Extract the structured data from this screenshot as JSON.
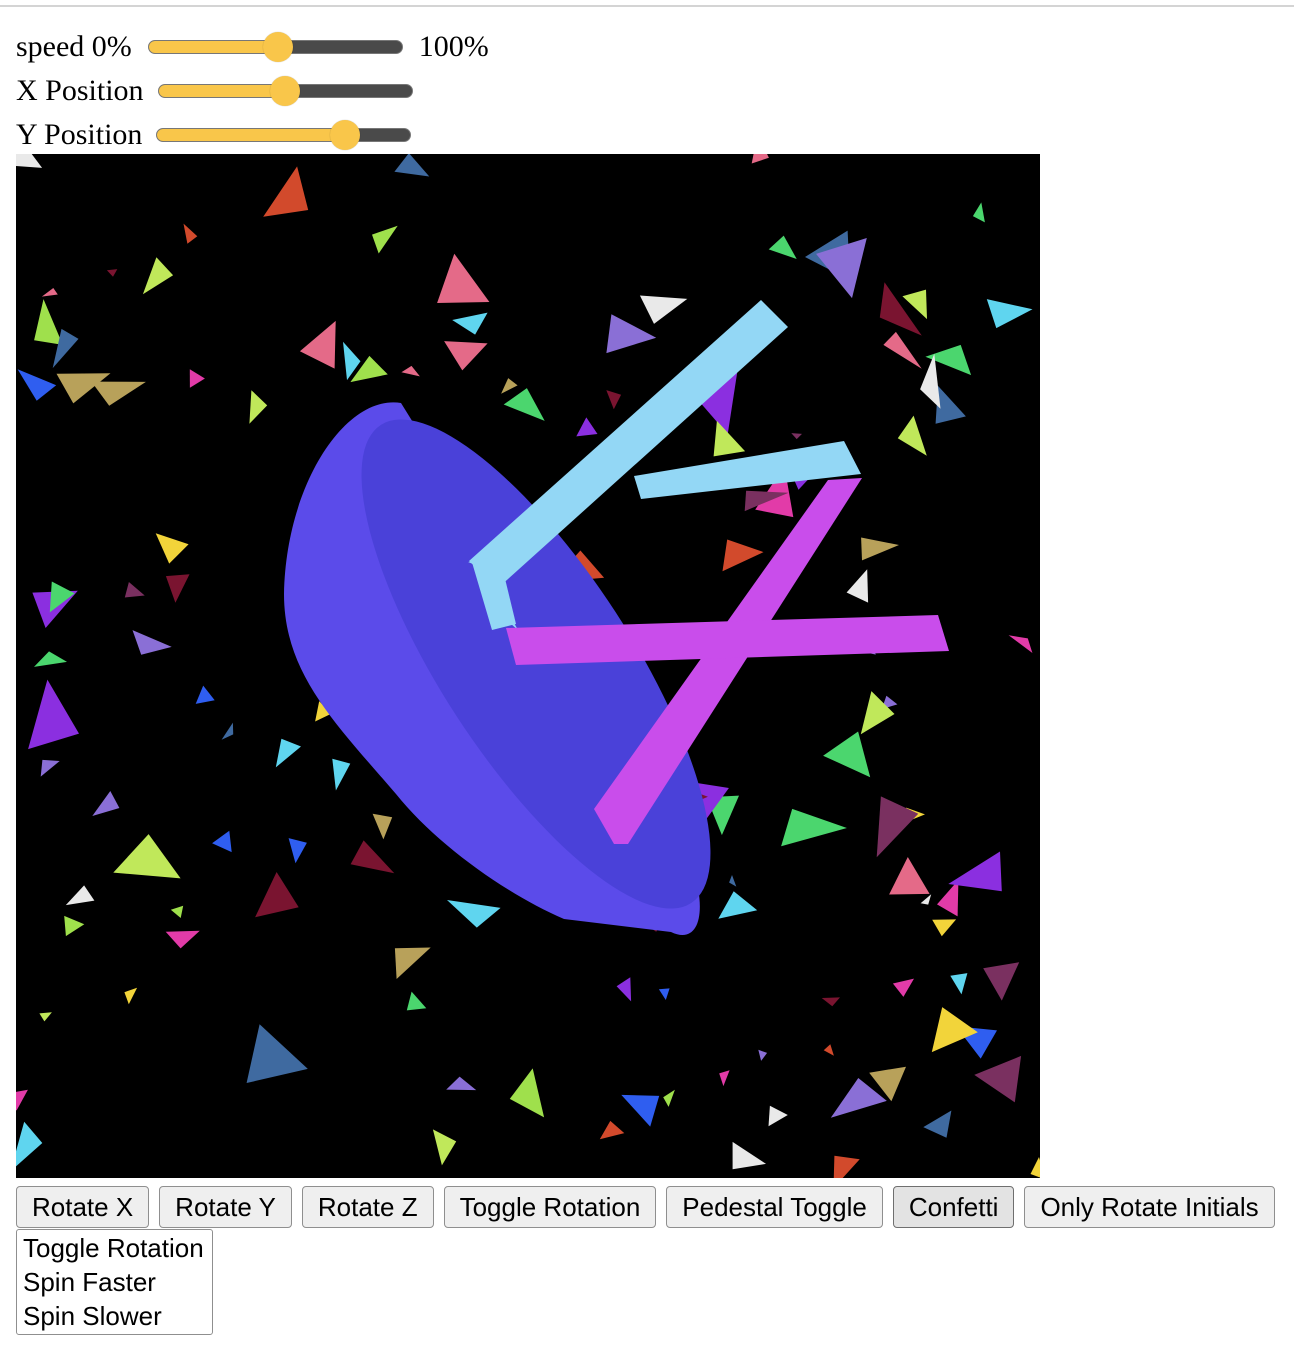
{
  "controls": {
    "speed": {
      "label": "speed 0%",
      "end_label": "100%",
      "value": 0.51
    },
    "x_position": {
      "label": "X Position",
      "value": 0.5
    },
    "y_position": {
      "label": "Y Position",
      "value": 0.74
    },
    "slider_fill_color": "#f9c64a",
    "slider_track_color": "#4a4a4a"
  },
  "scene": {
    "background": "#000000",
    "pedestal_color": "#5b4bea",
    "pedestal_face_color": "#4a41d9",
    "letter_y": {
      "char": "Y",
      "color": "#93d7f5"
    },
    "letter_x": {
      "char": "X",
      "color": "#c94deb"
    },
    "confetti_colors": [
      "#e23ba8",
      "#4bd66e",
      "#5fd5ef",
      "#f2d43a",
      "#8a6fd6",
      "#e46a88",
      "#2f5ef0",
      "#b8a15a",
      "#d24a2c",
      "#e9e9e9",
      "#7a3060",
      "#8b2fe0",
      "#9fe04c",
      "#3f6aa0",
      "#c0e85a",
      "#7a1430"
    ]
  },
  "buttons": [
    {
      "id": "rotate-x",
      "label": "Rotate X"
    },
    {
      "id": "rotate-y",
      "label": "Rotate Y"
    },
    {
      "id": "rotate-z",
      "label": "Rotate Z"
    },
    {
      "id": "toggle-rotation",
      "label": "Toggle Rotation"
    },
    {
      "id": "pedestal-toggle",
      "label": "Pedestal Toggle"
    },
    {
      "id": "confetti",
      "label": "Confetti",
      "active": true
    },
    {
      "id": "only-rotate-initials",
      "label": "Only Rotate Initials"
    }
  ],
  "listbox": {
    "options": [
      "Toggle Rotation",
      "Spin Faster",
      "Spin Slower"
    ]
  }
}
